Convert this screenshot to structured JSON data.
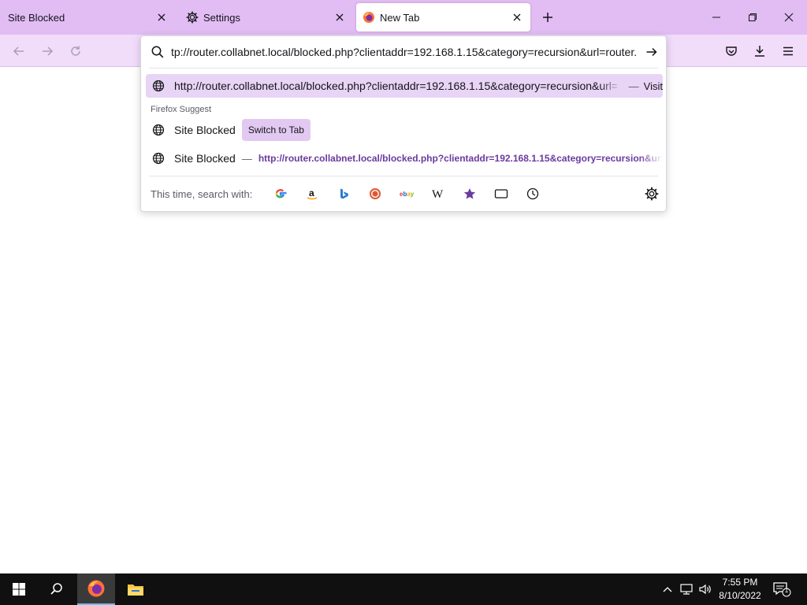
{
  "tabs": [
    {
      "title": "Site Blocked",
      "active": false
    },
    {
      "title": "Settings",
      "active": false,
      "icon": "gear-icon"
    },
    {
      "title": "New Tab",
      "active": true,
      "icon": "firefox-icon"
    }
  ],
  "urlbar": {
    "value": "tp://router.collabnet.local/blocked.php?clientaddr=192.168.1.15&category=recursion&url=router."
  },
  "suggestions": {
    "top_url": "http://router.collabnet.local/blocked.php?clientaddr=192.168.1.15&category=recursion&url=",
    "top_separator": "—",
    "top_action": "Visit",
    "group_label": "Firefox Suggest",
    "items": [
      {
        "title": "Site Blocked",
        "action": "Switch to Tab"
      },
      {
        "title": "Site Blocked",
        "separator": "—",
        "url": "http://router.collabnet.local/blocked.php?clientaddr=192.168.1.15&category=recursion&url="
      }
    ]
  },
  "search_footer": {
    "label": "This time, search with:",
    "engines": [
      "google-icon",
      "amazon-icon",
      "bing-icon",
      "duckduckgo-icon",
      "ebay-icon",
      "wikipedia-icon",
      "bookmarks-icon",
      "tabs-icon",
      "history-icon"
    ]
  },
  "taskbar": {
    "time": "7:55 PM",
    "date": "8/10/2022",
    "notification_count": "1"
  },
  "colors": {
    "tabstrip": "#e2bdf4",
    "navbar": "#f1dcfa",
    "highlight": "#e8d4f5",
    "accent_link": "#6b3aa0",
    "taskbar": "#101010"
  }
}
